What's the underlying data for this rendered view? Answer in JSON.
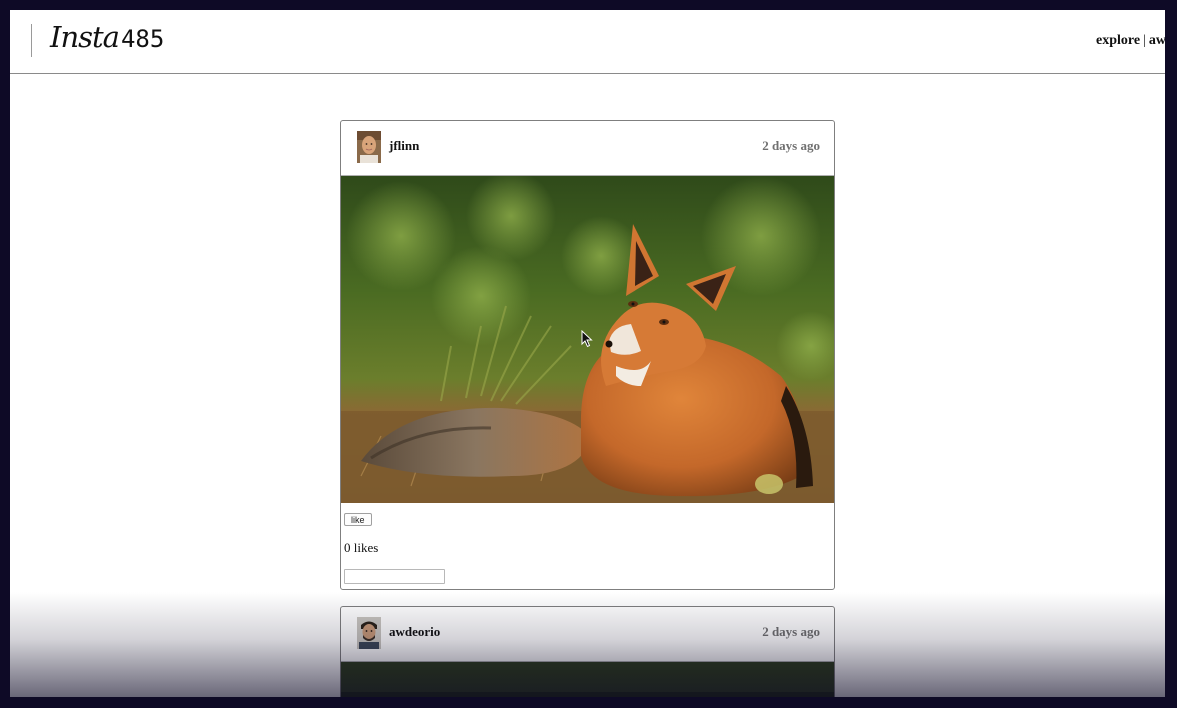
{
  "header": {
    "logo_script": "Insta",
    "logo_number": "485",
    "nav_explore": "explore",
    "nav_separator": "|",
    "nav_user": "awdeorio"
  },
  "posts": [
    {
      "username": "jflinn",
      "timestamp": "2 days ago",
      "like_label": "like",
      "likes_text": "0 likes",
      "comment_value": ""
    },
    {
      "username": "awdeorio",
      "timestamp": "2 days ago"
    }
  ],
  "colors": {
    "frame": "#0e0a26",
    "card_border": "#7f7f7f",
    "timestamp": "#707070"
  },
  "icons": {
    "cursor": "cursor-arrow-icon"
  }
}
